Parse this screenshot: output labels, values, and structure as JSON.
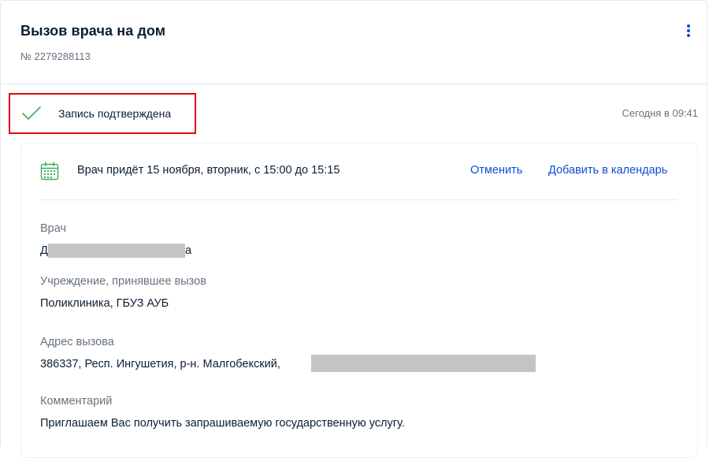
{
  "header": {
    "title": "Вызов врача на дом",
    "order_number": "№ 2279288113"
  },
  "status": {
    "text": "Запись подтверждена",
    "time": "Сегодня в 09:41",
    "icon": "check-icon",
    "icon_color": "#3dae5d",
    "highlight_color": "#e30613"
  },
  "visit": {
    "icon": "calendar-icon",
    "text": "Врач придёт 15 ноября, вторник, с 15:00 до 15:15",
    "cancel_label": "Отменить",
    "add_calendar_label": "Добавить в календарь"
  },
  "details": {
    "doctor_label": "Врач",
    "doctor_value_start": "Д",
    "doctor_value_end": "а",
    "institution_label": "Учреждение, принявшее вызов",
    "institution_value": "Поликлиника, ГБУЗ АУБ",
    "address_label": "Адрес вызова",
    "address_value": "386337, Респ. Ингушетия, р-н. Малгобекский,",
    "comment_label": "Комментарий",
    "comment_value": "Приглашаем Вас получить запрашиваемую государственную услугу."
  },
  "colors": {
    "link": "#0d4cd3",
    "muted": "#66727f",
    "text": "#0b1f33"
  }
}
